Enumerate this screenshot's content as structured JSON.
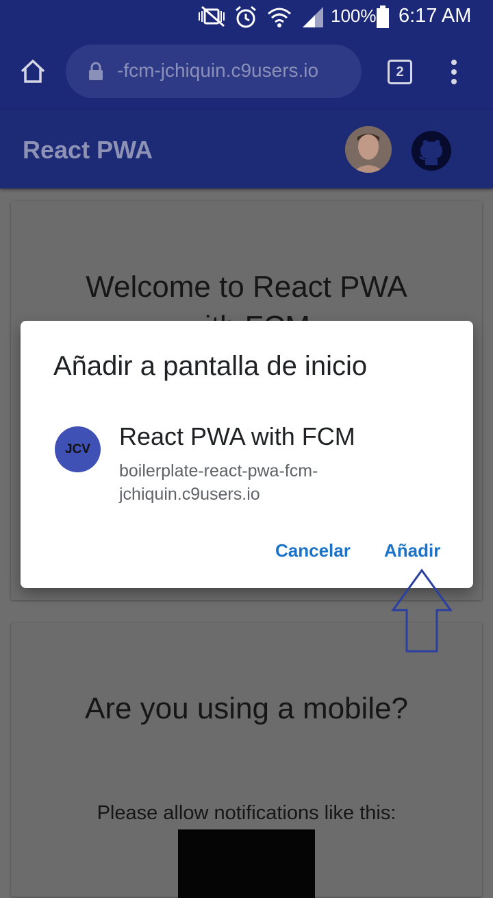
{
  "status_bar": {
    "battery": "100%",
    "time": "6:17 AM"
  },
  "browser": {
    "url": "-fcm-jchiquin.c9users.io",
    "tab_count": "2"
  },
  "app": {
    "title": "React PWA"
  },
  "content": {
    "welcome_heading": "Welcome to React PWA",
    "welcome_heading_line2": "with FCM",
    "mobile_heading": "Are you using a mobile?",
    "notifications_text": "Please allow notifications like this:"
  },
  "dialog": {
    "title": "Añadir a pantalla de inicio",
    "icon_text": "JCV",
    "app_name": "React PWA with FCM",
    "app_url_line1": "boilerplate-react-pwa-fcm-",
    "app_url_line2": "jchiquin.c9users.io",
    "cancel_label": "Cancelar",
    "add_label": "Añadir"
  },
  "colors": {
    "toolbar": "#1c2878",
    "accent": "#1a73c8",
    "icon_bg": "#3f51b5"
  }
}
